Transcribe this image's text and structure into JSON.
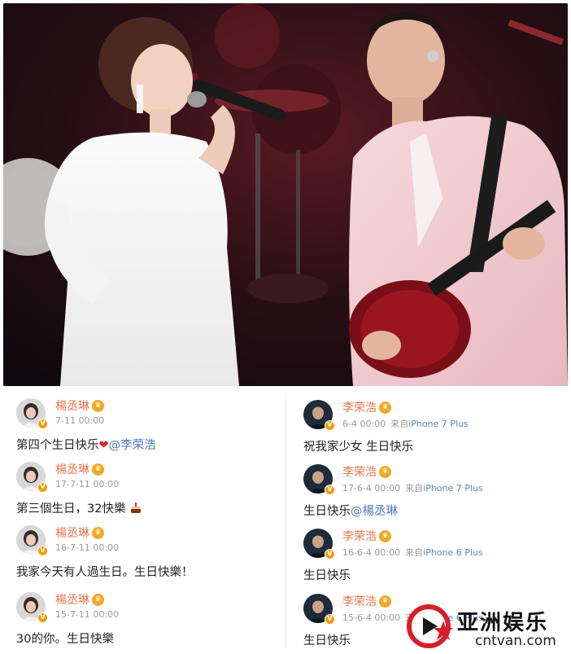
{
  "watermark": {
    "title": "亚洲娱乐",
    "url": "cntvan.com"
  },
  "left_posts": [
    {
      "user": "楊丞琳",
      "meta": "7-11 00:00",
      "text": "第四个生日快乐",
      "mention": "@李荣浩"
    },
    {
      "user": "楊丞琳",
      "meta": "17-7-11 00:00",
      "text": "第三個生日，32快樂"
    },
    {
      "user": "楊丞琳",
      "meta": "16-7-11 00:00",
      "text": "我家今天有人過生日。生日快樂！"
    },
    {
      "user": "楊丞琳",
      "meta": "15-7-11 00:00",
      "text": "30的你。生日快樂"
    }
  ],
  "right_posts": [
    {
      "user": "李荣浩",
      "meta": "6-4 00:00",
      "from": "来自",
      "device": "iPhone 7 Plus",
      "text": "祝我家少女 生日快乐"
    },
    {
      "user": "李荣浩",
      "meta": "17-6-4 00:00",
      "from": "来自",
      "device": "iPhone 7 Plus",
      "text": "生日快乐",
      "mention": "@楊丞琳"
    },
    {
      "user": "李荣浩",
      "meta": "16-6-4 00:00",
      "from": "来自",
      "device": "iPhone 6 Plus",
      "text": "生日快乐"
    },
    {
      "user": "李荣浩",
      "meta": "15-6-4 00:00",
      "from": "来自",
      "device": "iPhone 6 Plus",
      "text": "生日快乐"
    }
  ],
  "colors": {
    "username": "#eb7350",
    "mention": "#4d7bb5",
    "heart": "#e0262c",
    "badge": "#f39c12"
  },
  "icons": {
    "verified": "verified-badge-icon",
    "crown": "vip-crown-icon",
    "heart": "heart-icon",
    "birthday_cake": "cake-emoji-icon"
  }
}
